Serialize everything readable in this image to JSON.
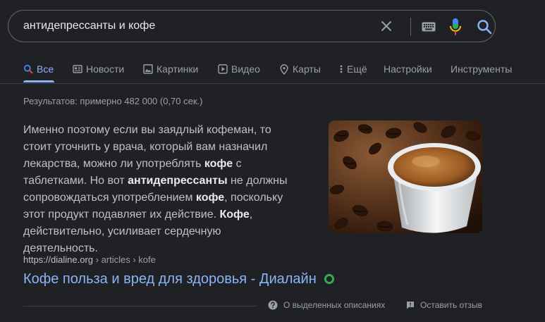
{
  "search": {
    "query": "антидепрессанты и кофе"
  },
  "tabs": [
    {
      "label": "Все",
      "icon": "search-icon",
      "active": true
    },
    {
      "label": "Новости",
      "icon": "news-icon"
    },
    {
      "label": "Картинки",
      "icon": "image-icon"
    },
    {
      "label": "Видео",
      "icon": "video-icon"
    },
    {
      "label": "Карты",
      "icon": "map-pin-icon"
    },
    {
      "label": "Ещё",
      "icon": "more-vert-icon"
    },
    {
      "label": "Настройки"
    },
    {
      "label": "Инструменты"
    }
  ],
  "stats": "Результатов: примерно 482 000 (0,70 сек.)",
  "snippet": {
    "parts": [
      {
        "text": "Именно поэтому если вы заядлый кофеман, то стоит уточнить у врача, который вам назначил лекарства, можно ли употреблять "
      },
      {
        "text": "кофе",
        "bold": true
      },
      {
        "text": " с таблетками. Но вот "
      },
      {
        "text": "антидепрессанты",
        "bold": true
      },
      {
        "text": " не должны сопровождаться употреблением "
      },
      {
        "text": "кофе",
        "bold": true
      },
      {
        "text": ", поскольку этот продукт подавляет их действие. "
      },
      {
        "text": "Кофе",
        "bold": true
      },
      {
        "text": ", действительно, усиливает сердечную деятельность."
      }
    ]
  },
  "result": {
    "domain": "https://dialine.org",
    "path": " › articles › kofe",
    "title": "Кофе польза и вред для здоровья - Диалайн"
  },
  "footer": {
    "about": "О выделенных описаниях",
    "feedback": "Оставить отзыв"
  },
  "colors": {
    "background": "#202124",
    "link": "#8ab4f8",
    "text": "#bdc1c6",
    "muted": "#9aa0a6",
    "secure_badge": "#34a853"
  }
}
